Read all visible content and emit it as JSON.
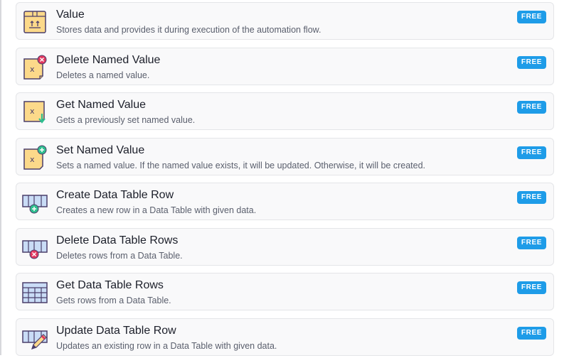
{
  "items": [
    {
      "title": "Value",
      "description": "Stores data and provides it during execution of the automation flow.",
      "badge": "FREE",
      "icon": "value-box-icon"
    },
    {
      "title": "Delete Named Value",
      "description": "Deletes a named value.",
      "badge": "FREE",
      "icon": "delete-named-value-icon"
    },
    {
      "title": "Get Named Value",
      "description": "Gets a previously set named value.",
      "badge": "FREE",
      "icon": "get-named-value-icon"
    },
    {
      "title": "Set Named Value",
      "description": "Sets a named value. If the named value exists, it will be updated. Otherwise, it will be created.",
      "badge": "FREE",
      "icon": "set-named-value-icon"
    },
    {
      "title": "Create Data Table Row",
      "description": "Creates a new row in a Data Table with given data.",
      "badge": "FREE",
      "icon": "create-table-row-icon"
    },
    {
      "title": "Delete Data Table Rows",
      "description": "Deletes rows from a Data Table.",
      "badge": "FREE",
      "icon": "delete-table-rows-icon"
    },
    {
      "title": "Get Data Table Rows",
      "description": "Gets rows from a Data Table.",
      "badge": "FREE",
      "icon": "get-table-rows-icon"
    },
    {
      "title": "Update Data Table Row",
      "description": "Updates an existing row in a Data Table with given data.",
      "badge": "FREE",
      "icon": "update-table-row-icon"
    }
  ],
  "colors": {
    "badge": "#1e9ce8",
    "note_fill": "#fcd98a",
    "table_fill": "#c9dcf6",
    "outline": "#4b3f6b",
    "green": "#2fbf8f",
    "red": "#e2375f"
  }
}
